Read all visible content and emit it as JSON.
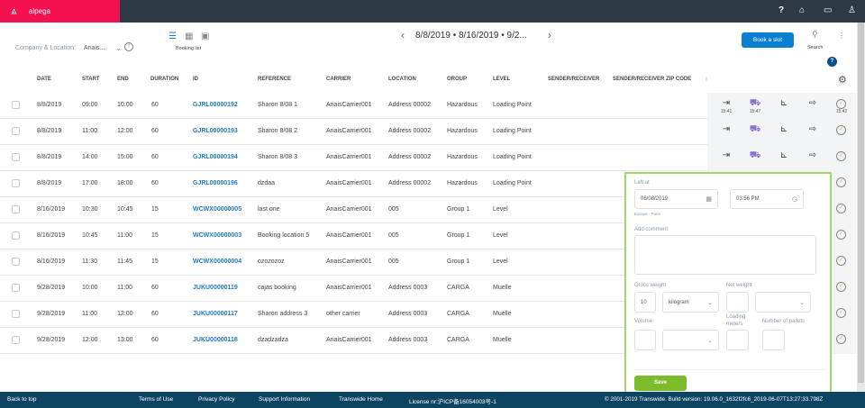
{
  "topbar": {
    "brand": "alpega",
    "icons": [
      "help-icon",
      "home-icon",
      "chat-icon",
      "user-icon"
    ],
    "brand_color": "#f5104f"
  },
  "filter": {
    "label": "Company & Location:",
    "value": "Anais..."
  },
  "views": {
    "active_label": "Booking list"
  },
  "date_nav": {
    "dates": "8/8/2019 • 8/16/2019 • 9/2..."
  },
  "toolbar": {
    "book_label": "Book a slot",
    "search_label": "Search",
    "help": "?",
    "accent": "#0b7fd1"
  },
  "table": {
    "headers": [
      "DATE",
      "START",
      "END",
      "DURATION",
      "ID",
      "REFERENCE",
      "CARRIER",
      "LOCATION",
      "GROUP",
      "LEVEL",
      "SENDER/RECEIVER",
      "SENDER/RECEIVER ZIP CODE"
    ],
    "rows": [
      [
        "8/8/2019",
        "09:00",
        "10:00",
        "60",
        "GJRL00000192",
        "Sharon 8/08 1",
        "AnaisCarrier001",
        "Address 00002",
        "Hazardous",
        "Loading Point"
      ],
      [
        "8/8/2019",
        "11:00",
        "12:00",
        "60",
        "GJRL00000193",
        "Sharon 8/08 2",
        "AnaisCarrier001",
        "Address 00002",
        "Hazardous",
        "Loading Point"
      ],
      [
        "8/8/2019",
        "14:00",
        "15:00",
        "60",
        "GJRL00000194",
        "Sharon 8/08 3",
        "AnaisCarrier001",
        "Address 00002",
        "Hazardous",
        "Loading Point"
      ],
      [
        "8/8/2019",
        "17:00",
        "18:00",
        "60",
        "GJRL00000196",
        "dzdaa",
        "AnaisCarrier001",
        "Address 00002",
        "Hazardous",
        "Loading Point"
      ],
      [
        "8/16/2019",
        "10:30",
        "10:45",
        "15",
        "WCWX00000005",
        "last one",
        "AnaisCarrier001",
        "005",
        "Group 1",
        "Level"
      ],
      [
        "8/16/2019",
        "10:45",
        "11:00",
        "15",
        "WCWX00000003",
        "Booking location 5",
        "AnaisCarrier001",
        "005",
        "Group 1",
        "Level"
      ],
      [
        "8/16/2019",
        "11:30",
        "11:45",
        "15",
        "WCWX00000004",
        "ozozozoz",
        "AnaisCarrier001",
        "005",
        "Group 1",
        "Level"
      ],
      [
        "9/28/2019",
        "10:00",
        "11:00",
        "60",
        "JUKU00000119",
        "cajas booking",
        "AnaisCarrier001",
        "Address 0003",
        "CARGA",
        "Muelle"
      ],
      [
        "9/28/2019",
        "11:00",
        "12:00",
        "60",
        "JUKU00000117",
        "Sharon address 3",
        "other carrier",
        "Address 0003",
        "CARGA",
        "Muelle"
      ],
      [
        "9/28/2019",
        "12:00",
        "13:00",
        "60",
        "JUKU00000118",
        "dzadzadza",
        "AnaisCarrier001",
        "Address 0003",
        "CARGA",
        "Muelle"
      ]
    ],
    "first_row_times": [
      "15:41",
      "15:47",
      "15:42"
    ]
  },
  "popup": {
    "left_at": "Left at",
    "date": "08/08/2019",
    "time": "03:56 PM",
    "timezone": "Europe - Paris",
    "comment_label": "Add comment",
    "gross_label": "Gross weight",
    "gross_value": "10",
    "gross_unit": "kilogram",
    "net_label": "Net weight",
    "volume_label": "Volume",
    "loading_label": "Loading meters",
    "pallets_label": "Number of pallets",
    "save_label": "Save",
    "save_color": "#7cbb2a"
  },
  "footer": {
    "back": "Back to top",
    "terms": "Terms of Use",
    "privacy": "Privacy Policy",
    "support": "Support Information",
    "home": "Transwide Home",
    "license": "License nr:沪ICP备16054003号-1",
    "copyright": "© 2001-2019 Transwide. Build version: 19.06.0_1632f2fc6_2019-06-07T13:27:33.798Z"
  }
}
